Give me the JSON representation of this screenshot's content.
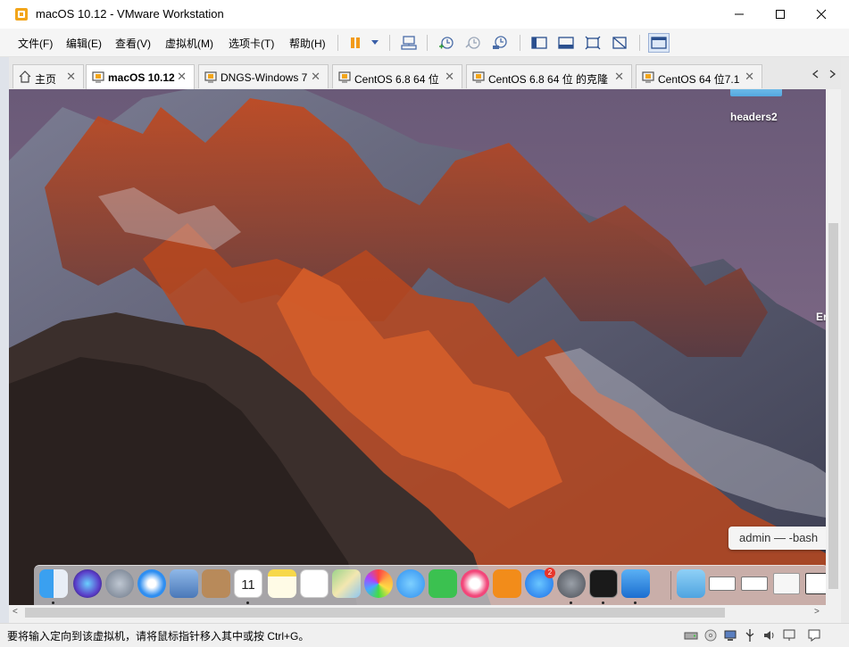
{
  "window": {
    "title": "macOS 10.12 - VMware Workstation"
  },
  "menu": {
    "items": [
      "文件(F)",
      "编辑(E)",
      "查看(V)",
      "虚拟机(M)",
      "选项卡(T)",
      "帮助(H)"
    ]
  },
  "toolbar": {
    "icons": [
      "pause-icon",
      "send-ctrl-alt-del-icon",
      "snapshot-take-icon",
      "snapshot-revert-icon",
      "snapshot-manager-icon",
      "library-view-icon",
      "single-view-icon",
      "fit-guest-icon",
      "unity-icon",
      "fullscreen-icon"
    ]
  },
  "tabs": [
    {
      "label": "主页",
      "icon": "home-icon",
      "active": false
    },
    {
      "label": "macOS 10.12",
      "icon": "vm-icon",
      "active": true
    },
    {
      "label": "DNGS-Windows 7",
      "icon": "vm-icon",
      "active": false
    },
    {
      "label": "CentOS 6.8 64 位",
      "icon": "vm-icon",
      "active": false
    },
    {
      "label": "CentOS 6.8 64 位 的克隆",
      "icon": "vm-icon",
      "active": false
    },
    {
      "label": "CentOS 64 位7.1",
      "icon": "vm-icon",
      "active": false
    }
  ],
  "vm": {
    "desktop_items": {
      "folder_label": "headers2",
      "partial_label": "Er"
    },
    "terminal_tooltip": "admin — -bash",
    "dock": {
      "apps": [
        "finder",
        "siri",
        "launchpad",
        "safari",
        "mail-stamp",
        "contacts",
        "calendar",
        "notes",
        "reminders",
        "maps",
        "photos",
        "messages",
        "facetime",
        "itunes",
        "ibooks",
        "app-store",
        "system-preferences",
        "terminal",
        "xcode"
      ],
      "calendar_day": "11",
      "app_store_badge": "2"
    }
  },
  "statusbar": {
    "message": "要将输入定向到该虚拟机，请将鼠标指针移入其中或按 Ctrl+G。"
  },
  "colors": {
    "accent": "#3a5fa8",
    "tab_active_bg": "#ffffff",
    "titlebar_bg": "#ffffff"
  }
}
